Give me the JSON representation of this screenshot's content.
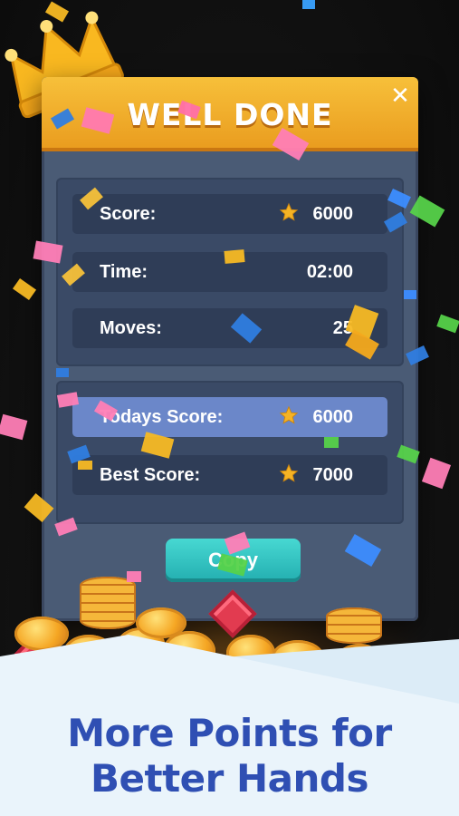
{
  "dialog": {
    "title": "WELL DONE",
    "close_icon": "close-icon"
  },
  "stats": {
    "score_label": "Score:",
    "score_value": "6000",
    "time_label": "Time:",
    "time_value": "02:00",
    "moves_label": "Moves:",
    "moves_value": "25"
  },
  "records": {
    "todays_label": "Todays Score:",
    "todays_value": "6000",
    "best_label": "Best Score:",
    "best_value": "7000"
  },
  "copy_button_label": "Copy",
  "tagline": {
    "line1": "More Points for",
    "line2": "Better Hands"
  },
  "colors": {
    "header": "#f2b230",
    "panel": "#3a4a66",
    "highlight_row": "#6b87c9",
    "button": "#35c4c2",
    "tagline": "#2f4fb3"
  }
}
